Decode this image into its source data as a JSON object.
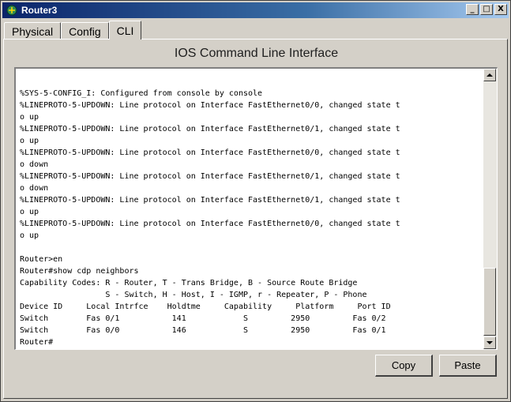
{
  "window": {
    "title": "Router3",
    "controls": {
      "minimize": "_",
      "maximize": "□",
      "close": "X"
    }
  },
  "tabs": [
    {
      "label": "Physical",
      "active": false
    },
    {
      "label": "Config",
      "active": false
    },
    {
      "label": "CLI",
      "active": true
    }
  ],
  "pane": {
    "title": "IOS Command Line Interface"
  },
  "terminal": {
    "lines": [
      "%SYS-5-CONFIG_I: Configured from console by console",
      "%LINEPROTO-5-UPDOWN: Line protocol on Interface FastEthernet0/0, changed state t",
      "o up",
      "%LINEPROTO-5-UPDOWN: Line protocol on Interface FastEthernet0/1, changed state t",
      "o up",
      "%LINEPROTO-5-UPDOWN: Line protocol on Interface FastEthernet0/0, changed state t",
      "o down",
      "%LINEPROTO-5-UPDOWN: Line protocol on Interface FastEthernet0/1, changed state t",
      "o down",
      "%LINEPROTO-5-UPDOWN: Line protocol on Interface FastEthernet0/1, changed state t",
      "o up",
      "%LINEPROTO-5-UPDOWN: Line protocol on Interface FastEthernet0/0, changed state t",
      "o up",
      "",
      "Router>en",
      "Router#show cdp neighbors",
      "Capability Codes: R - Router, T - Trans Bridge, B - Source Route Bridge",
      "                  S - Switch, H - Host, I - IGMP, r - Repeater, P - Phone",
      "Device ID     Local Intrfce    Holdtme     Capability     Platform     Port ID",
      "Switch        Fas 0/1           141            S         2950         Fas 0/2",
      "Switch        Fas 0/0           146            S         2950         Fas 0/1",
      "Router#"
    ]
  },
  "buttons": {
    "copy": "Copy",
    "paste": "Paste"
  }
}
